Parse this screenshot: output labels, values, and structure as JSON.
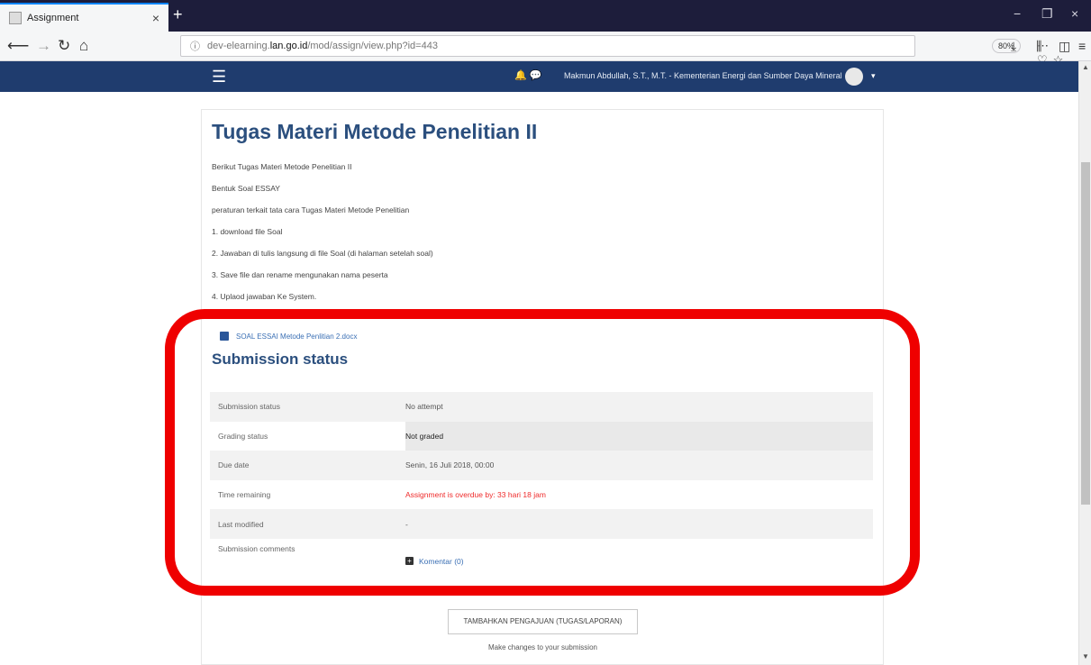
{
  "browser": {
    "tab_title": "Assignment",
    "tab_close": "×",
    "new_tab": "+",
    "url_prefix": "dev-elearning.",
    "url_domain": "lan.go.id",
    "url_path": "/mod/assign/view.php?id=443",
    "zoom": "80%",
    "win_min": "−",
    "win_restore": "❐",
    "win_close": "×"
  },
  "header": {
    "menu_icon": "☰",
    "user_name": "Makmun Abdullah, S.T., M.T. - Kementerian Energi dan Sumber Daya Mineral",
    "caret": "▾"
  },
  "main": {
    "title": "Tugas Materi Metode Penelitian II",
    "intro_lines": [
      "Berikut Tugas Materi Metode Penelitian II",
      "Bentuk Soal ESSAY",
      "peraturan terkait tata cara Tugas Materi Metode Penelitian",
      "1. download file Soal",
      "2. Jawaban di tulis langsung di file Soal (di halaman setelah soal)",
      "3. Save file dan rename mengunakan nama peserta",
      "4. Uplaod jawaban Ke System."
    ],
    "attachment": "SOAL ESSAI Metode Penlitian 2.docx",
    "submission_heading": "Submission status",
    "status_rows": [
      {
        "label": "Submission status",
        "value": "No attempt"
      },
      {
        "label": "Grading status",
        "value": "Not graded"
      },
      {
        "label": "Due date",
        "value": "Senin, 16 Juli 2018, 00:00"
      },
      {
        "label": "Time remaining",
        "value": "Assignment is overdue by: 33 hari 18 jam"
      },
      {
        "label": "Last modified",
        "value": "-"
      },
      {
        "label": "Submission comments",
        "value": "Komentar (0)"
      }
    ],
    "submit_button": "TAMBAHKAN PENGAJUAN (TUGAS/LAPORAN)",
    "submit_help": "Make changes to your submission"
  },
  "colors": {
    "header_bg": "#1f3c6e",
    "title": "#2b4f7e",
    "overdue": "#ef2b2b",
    "highlight": "#ef0000"
  }
}
